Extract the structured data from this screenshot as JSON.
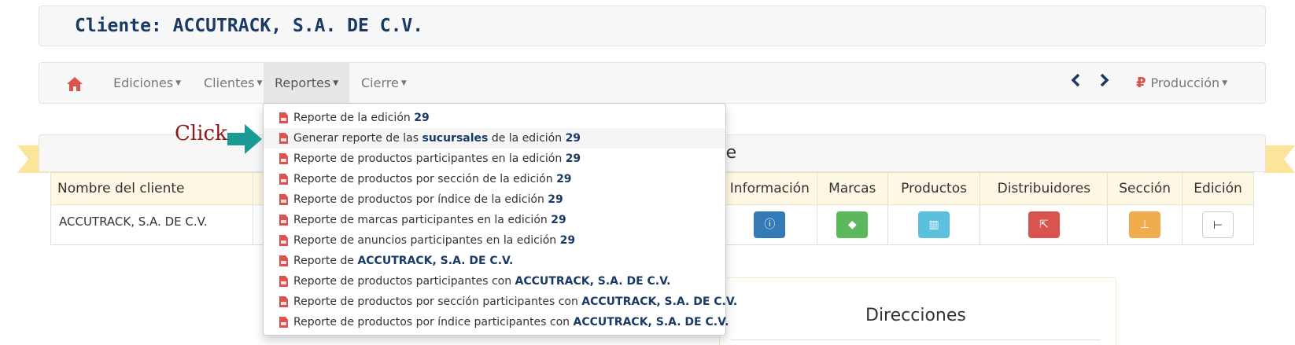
{
  "client_header": {
    "title": "Cliente: ACCUTRACK, S.A. DE C.V."
  },
  "navbar": {
    "home_icon": "home-icon",
    "ediciones": "Ediciones",
    "clientes": "Clientes",
    "reportes": "Reportes",
    "cierre": "Cierre",
    "prev_icon": "chevron-left-icon",
    "next_icon": "chevron-right-icon",
    "produccion": "Producción",
    "produccion_icon": "ruble-icon"
  },
  "dropdown": {
    "items": [
      {
        "pre": "Reporte de la edición ",
        "bold": "29",
        "post": ""
      },
      {
        "pre": "Generar reporte de las ",
        "bold": "sucursales",
        "post": " de la edición ",
        "bold2": "29"
      },
      {
        "pre": "Reporte de productos participantes en la edición ",
        "bold": "29",
        "post": ""
      },
      {
        "pre": "Reporte de productos por sección de la edición ",
        "bold": "29",
        "post": ""
      },
      {
        "pre": "Reporte de productos por índice de la edición ",
        "bold": "29",
        "post": ""
      },
      {
        "pre": "Reporte de marcas participantes en la edición ",
        "bold": "29",
        "post": ""
      },
      {
        "pre": "Reporte de anuncios participantes en la edición ",
        "bold": "29",
        "post": ""
      },
      {
        "pre": "Reporte de ",
        "bold": "ACCUTRACK, S.A. DE C.V.",
        "post": ""
      },
      {
        "pre": "Reporte de productos participantes con ",
        "bold": "ACCUTRACK, S.A. DE C.V.",
        "post": ""
      },
      {
        "pre": "Reporte de productos por sección participantes con ",
        "bold": "ACCUTRACK, S.A. DE C.V.",
        "post": ""
      },
      {
        "pre": "Reporte de productos por índice participantes con ",
        "bold": "ACCUTRACK, S.A. DE C.V.",
        "post": ""
      }
    ]
  },
  "annotation": {
    "click_label": "Click"
  },
  "panel": {
    "title_fragment": "nte"
  },
  "table": {
    "headers": {
      "name": "Nombre del cliente",
      "info": "Información",
      "brands": "Marcas",
      "products": "Productos",
      "distributors": "Distribuidores",
      "section": "Sección",
      "edition": "Edición"
    },
    "row": {
      "name": "ACCUTRACK, S.A. DE C.V."
    }
  },
  "directions": {
    "title": "Direcciones"
  },
  "colors": {
    "brand_navy": "#1a3a66",
    "pdf_red": "#d9534f",
    "ribbon": "#fde49b",
    "arrow_teal": "#1a9a94"
  }
}
